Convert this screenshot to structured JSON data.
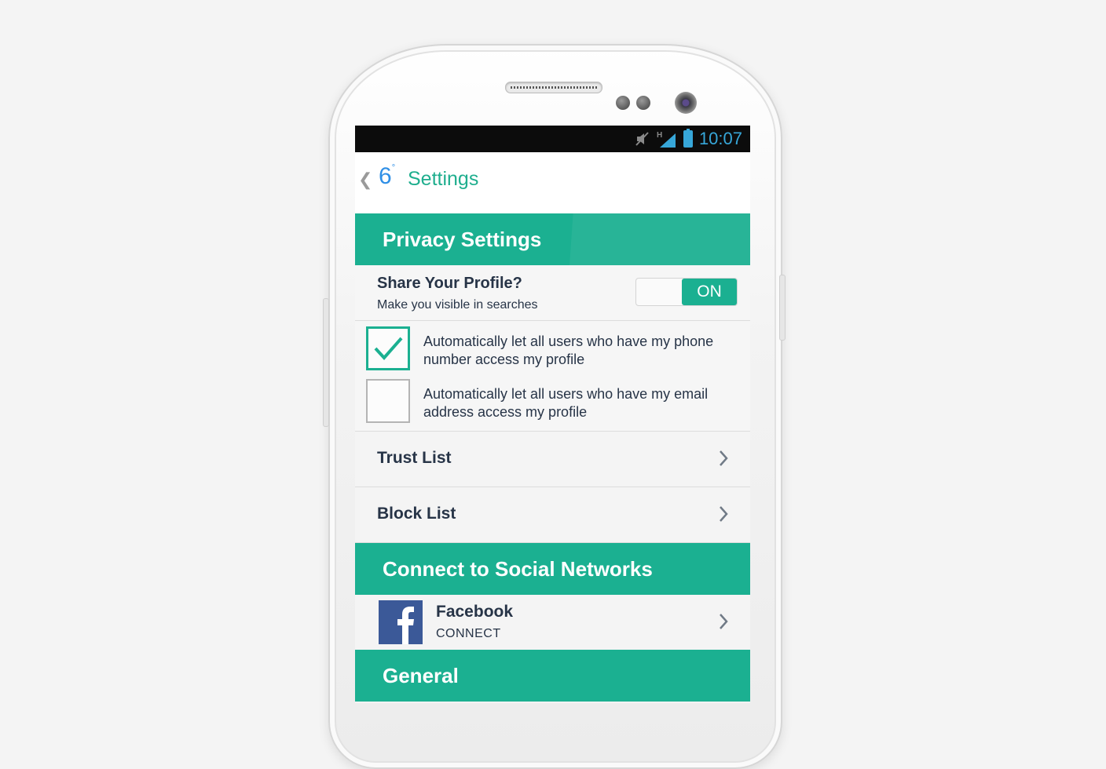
{
  "status_bar": {
    "time": "10:07",
    "signal_type": "H",
    "icons": [
      "mute-icon",
      "signal-icon",
      "battery-icon"
    ]
  },
  "app_bar": {
    "logo": "6",
    "logo_mark": "°",
    "title": "Settings",
    "back_icon": "chevron-left-icon"
  },
  "privacy": {
    "header": "Privacy Settings",
    "share_profile": {
      "title": "Share Your Profile?",
      "subtitle": "Make you visible in searches",
      "toggle_label": "ON",
      "toggle_on": true
    },
    "options": [
      {
        "label": "Automatically let all users who have my phone number access my profile",
        "checked": true
      },
      {
        "label": "Automatically let all users who have my email address access my profile",
        "checked": false
      }
    ],
    "lists": [
      {
        "label": "Trust List"
      },
      {
        "label": "Block List"
      }
    ]
  },
  "social": {
    "header": "Connect to Social Networks",
    "facebook": {
      "title": "Facebook",
      "action": "CONNECT",
      "icon": "facebook-icon"
    }
  },
  "general": {
    "header": "General"
  },
  "colors": {
    "accent": "#1bb091",
    "text": "#273447",
    "status_blue": "#37a7d9",
    "facebook": "#3b5998"
  }
}
